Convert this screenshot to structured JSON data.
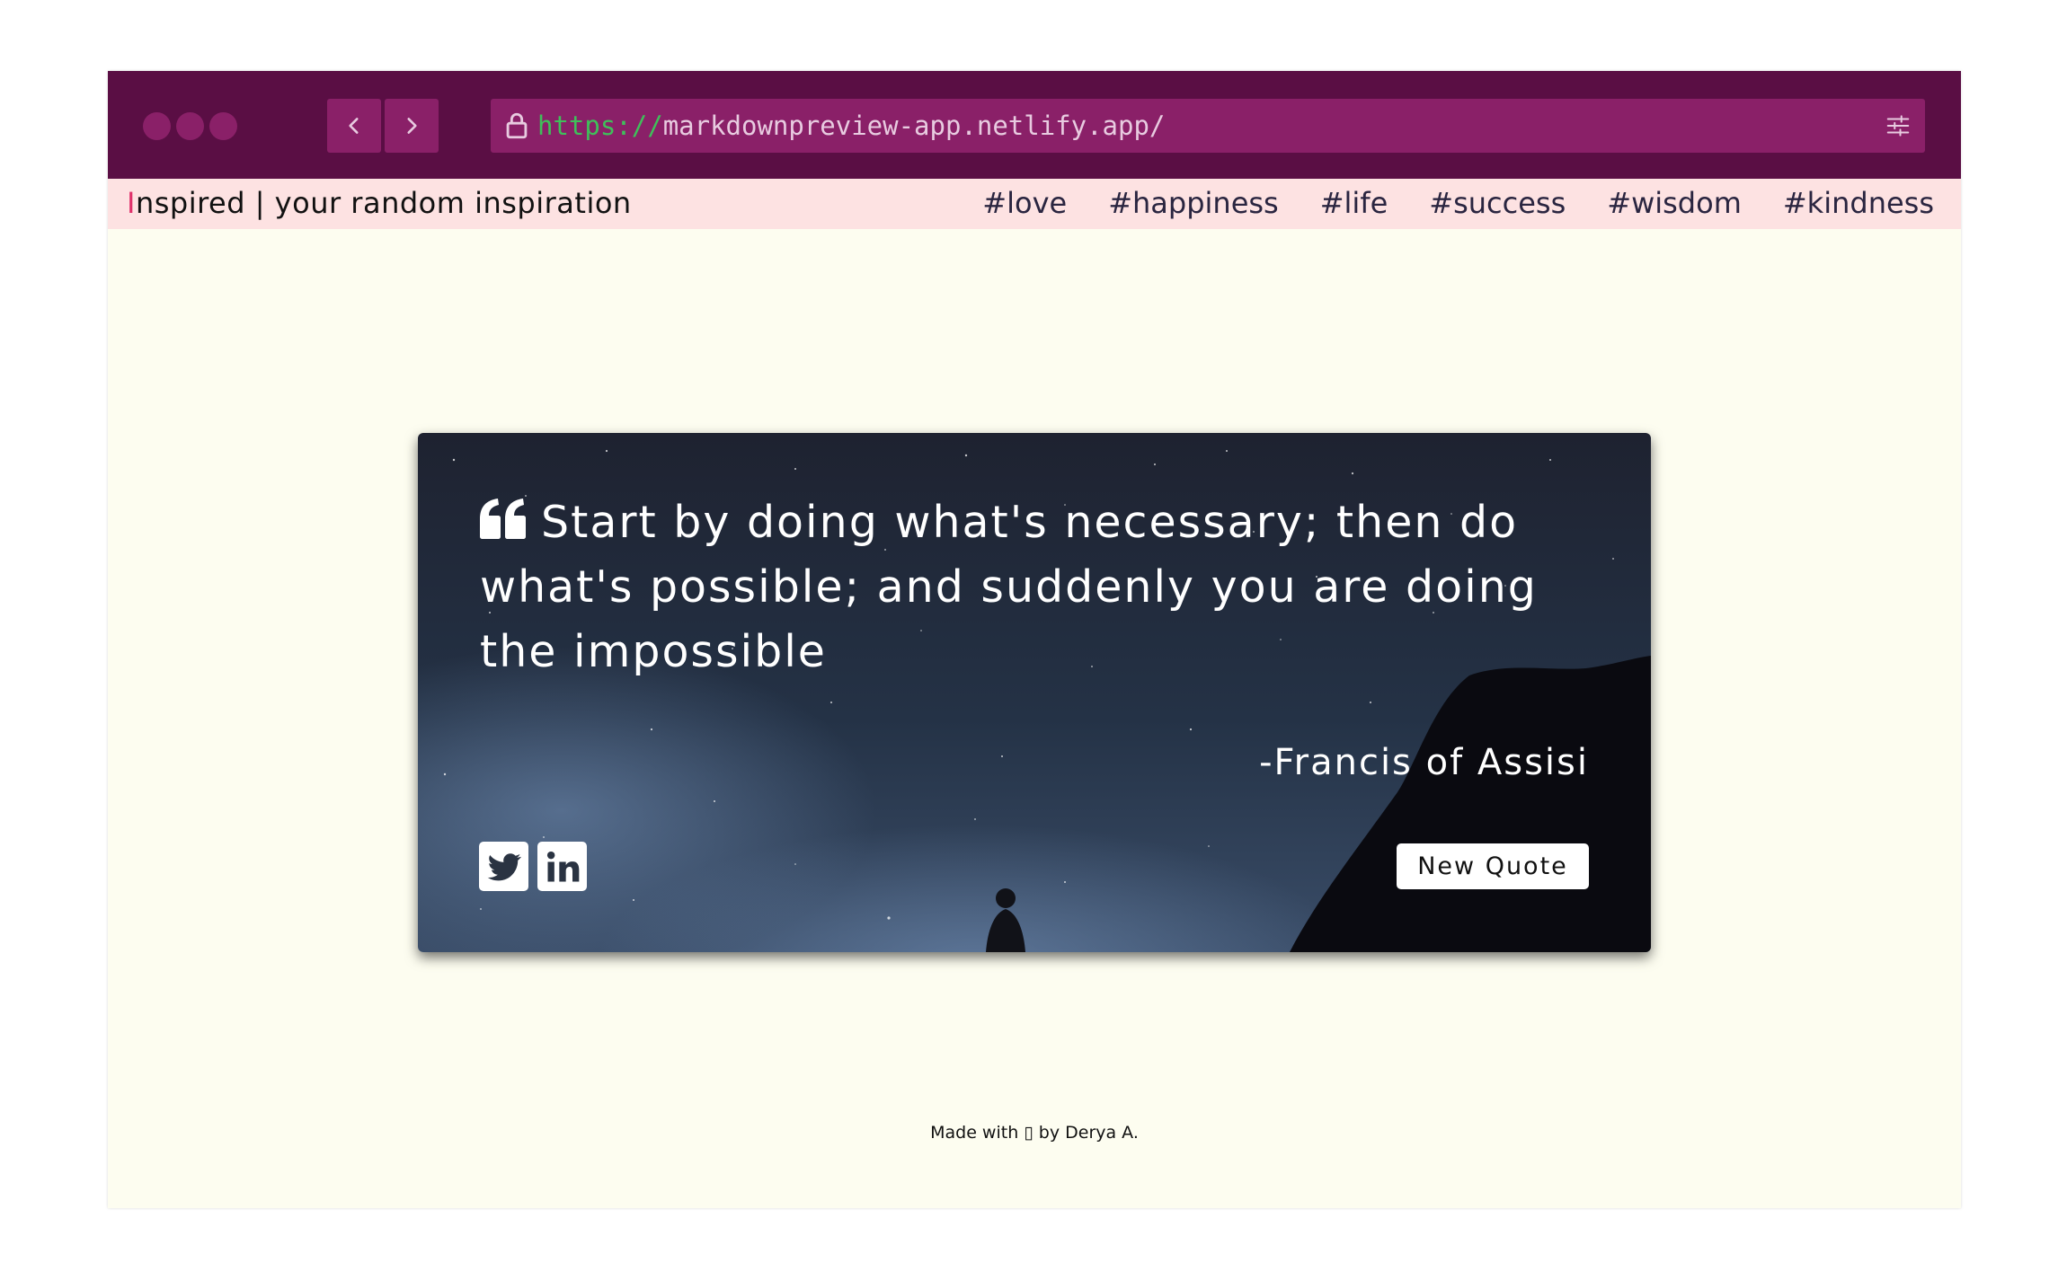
{
  "browser": {
    "url_scheme": "https://",
    "url_rest": "markdownpreview-app.netlify.app/"
  },
  "nav": {
    "brand_first": "I",
    "brand_rest": "nspired | your random inspiration",
    "tags": [
      "#love",
      "#happiness",
      "#life",
      "#success",
      "#wisdom",
      "#kindness"
    ]
  },
  "quote": {
    "text": "Start by doing what's necessary; then do what's possible; and suddenly you are doing the impossible",
    "author": "-Francis of Assisi",
    "new_quote_label": "New Quote"
  },
  "footer": {
    "text": "Made with ▯ by Derya A."
  },
  "icons": [
    "lock-icon",
    "chevron-left-icon",
    "chevron-right-icon",
    "sliders-icon",
    "quote-left-icon",
    "twitter-icon",
    "linkedin-icon"
  ],
  "colors": {
    "chrome": "#5a0e44",
    "chrome_button": "#8a2068",
    "nav_bg": "#fde2e2",
    "page_bg": "#fdfdf0",
    "brand_accent": "#e0316b",
    "url_scheme": "#3fbf5a"
  }
}
